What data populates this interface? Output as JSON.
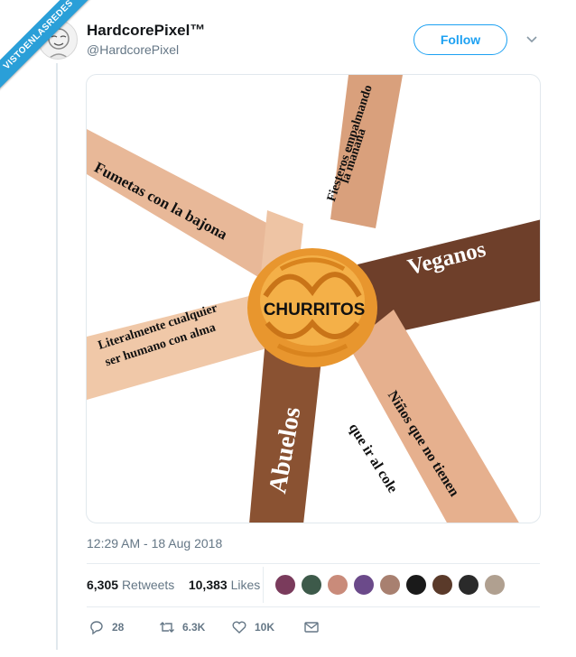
{
  "watermark": "VISTOENLASREDES",
  "tweet": {
    "display_name": "HardcorePixel™",
    "handle": "@HardcorePixel",
    "follow_label": "Follow",
    "timestamp": "12:29 AM - 18 Aug 2018"
  },
  "meme": {
    "center_label": "CHURRITOS",
    "labels": {
      "fumetas": "Fumetas con la bajona",
      "fiesteros_1": "Fiesteros empalmando",
      "fiesteros_2": "la mañana",
      "veganos": "Veganos",
      "literal_1": "Literalmente cualquier",
      "literal_2": "ser humano con alma",
      "abuelos": "Abuelos",
      "ninos_1": "Niños que no tienen",
      "ninos_2": "que ir al cole"
    }
  },
  "stats": {
    "retweets_count": "6,305",
    "retweets_label": "Retweets",
    "likes_count": "10,383",
    "likes_label": "Likes"
  },
  "likers": [
    "#7a3b5c",
    "#3d5a4a",
    "#c98b7a",
    "#6b4a8a",
    "#a88070",
    "#1a1a1a",
    "#5a3a2a",
    "#2a2a2a",
    "#b0a090"
  ],
  "actions": {
    "replies": "28",
    "retweets": "6.3K",
    "likes": "10K"
  },
  "colors": {
    "accent": "#1da1f2",
    "secondary_text": "#657786"
  }
}
